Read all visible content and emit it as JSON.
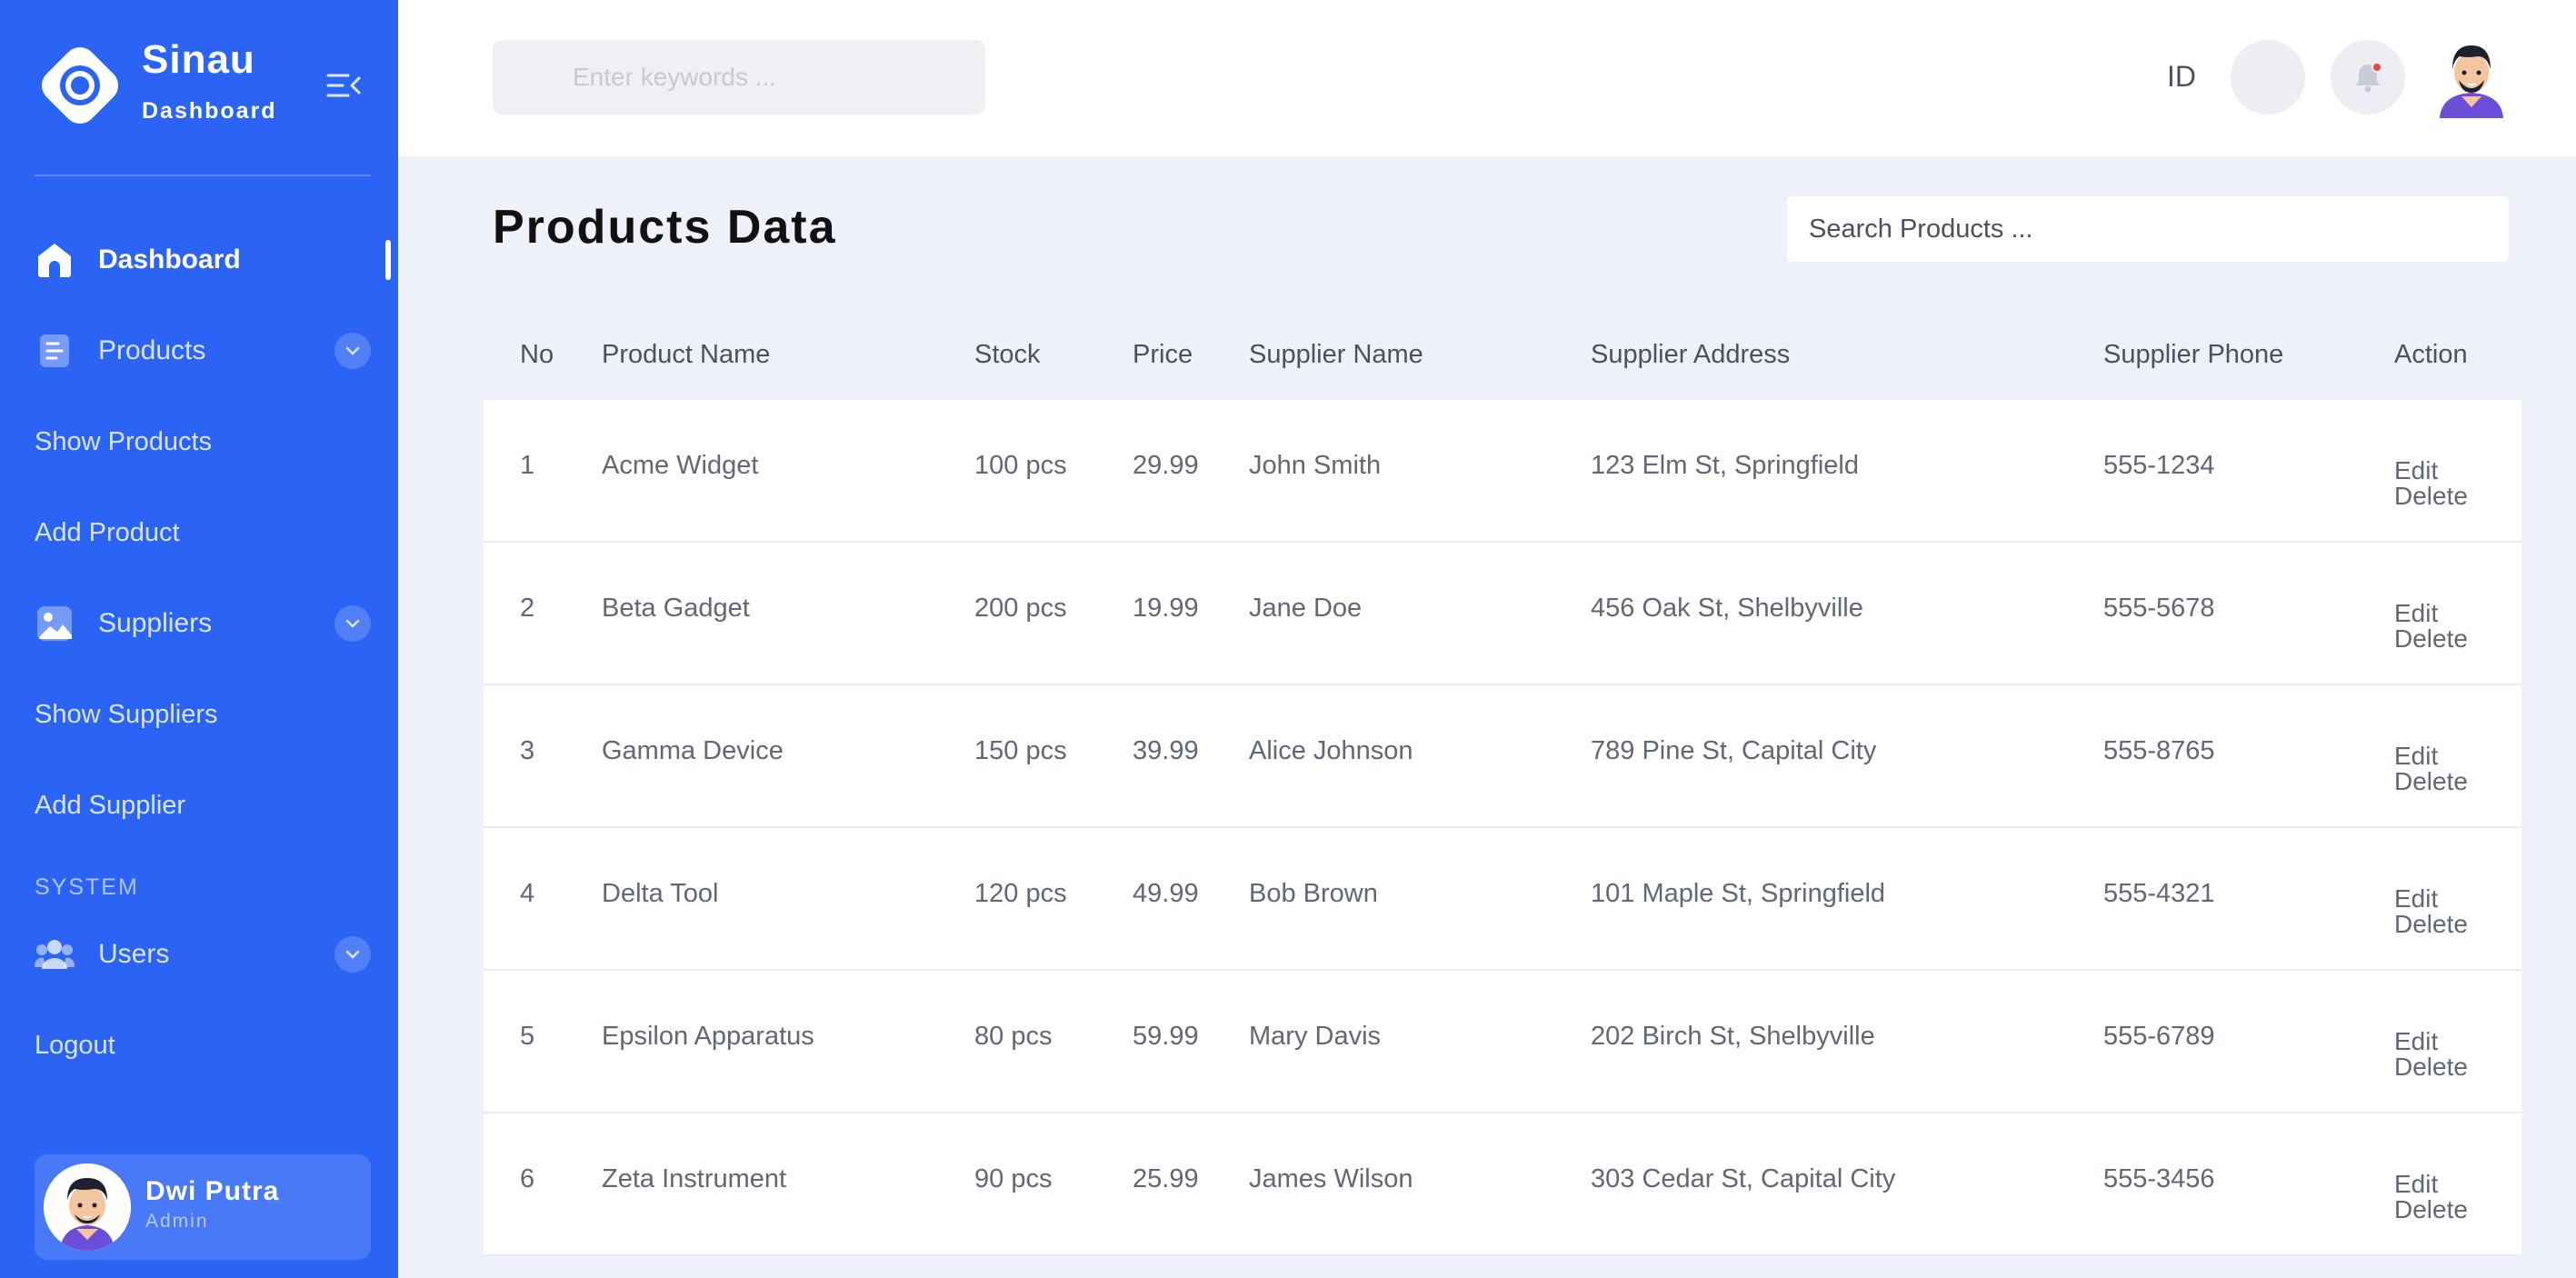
{
  "brand": {
    "title": "Sinau",
    "subtitle": "Dashboard"
  },
  "colors": {
    "sidebar": "#2b64f5",
    "page_bg": "#eef1f9",
    "notification_dot": "#f04438"
  },
  "sidebar": {
    "nav": {
      "dashboard": {
        "label": "Dashboard",
        "icon": "home-icon"
      },
      "products": {
        "label": "Products",
        "icon": "document-icon"
      },
      "suppliers": {
        "label": "Suppliers",
        "icon": "image-icon"
      },
      "users": {
        "label": "Users",
        "icon": "users-icon"
      }
    },
    "links": {
      "show_products": "Show Products",
      "add_product": "Add Product",
      "show_suppliers": "Show Suppliers",
      "add_supplier": "Add Supplier",
      "logout": "Logout"
    },
    "section_system": "SYSTEM",
    "user": {
      "name": "Dwi Putra",
      "role": "Admin"
    }
  },
  "topbar": {
    "search_placeholder": "Enter keywords ...",
    "language": "ID"
  },
  "main": {
    "title": "Products Data",
    "search_placeholder": "Search Products ...",
    "columns": [
      "No",
      "Product Name",
      "Stock",
      "Price",
      "Supplier Name",
      "Supplier Address",
      "Supplier Phone",
      "Action"
    ],
    "rows": [
      {
        "no": "1",
        "name": "Acme Widget",
        "stock": "100 pcs",
        "price": "29.99",
        "supplier": "John Smith",
        "address": "123 Elm St, Springfield",
        "phone": "555-1234"
      },
      {
        "no": "2",
        "name": "Beta Gadget",
        "stock": "200 pcs",
        "price": "19.99",
        "supplier": "Jane Doe",
        "address": "456 Oak St, Shelbyville",
        "phone": "555-5678"
      },
      {
        "no": "3",
        "name": "Gamma Device",
        "stock": "150 pcs",
        "price": "39.99",
        "supplier": "Alice Johnson",
        "address": "789 Pine St, Capital City",
        "phone": "555-8765"
      },
      {
        "no": "4",
        "name": "Delta Tool",
        "stock": "120 pcs",
        "price": "49.99",
        "supplier": "Bob Brown",
        "address": "101 Maple St, Springfield",
        "phone": "555-4321"
      },
      {
        "no": "5",
        "name": "Epsilon Apparatus",
        "stock": "80 pcs",
        "price": "59.99",
        "supplier": "Mary Davis",
        "address": "202 Birch St, Shelbyville",
        "phone": "555-6789"
      },
      {
        "no": "6",
        "name": "Zeta Instrument",
        "stock": "90 pcs",
        "price": "25.99",
        "supplier": "James Wilson",
        "address": "303 Cedar St, Capital City",
        "phone": "555-3456"
      }
    ],
    "actions": {
      "edit": "Edit",
      "delete": "Delete"
    }
  }
}
